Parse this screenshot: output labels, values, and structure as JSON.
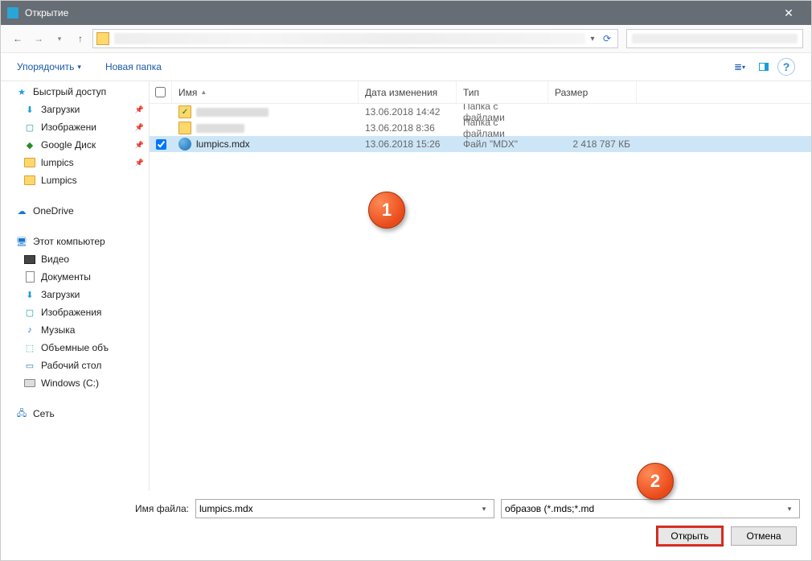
{
  "titlebar": {
    "title": "Открытие"
  },
  "toolbar": {
    "organize": "Упорядочить",
    "new_folder": "Новая папка"
  },
  "sidebar": {
    "quick_access": "Быстрый доступ",
    "downloads": "Загрузки",
    "images": "Изображени",
    "google_drive": "Google Диск",
    "lumpics": "lumpics",
    "lumpics2": "Lumpics",
    "onedrive": "OneDrive",
    "this_pc": "Этот компьютер",
    "video": "Видео",
    "documents": "Документы",
    "downloads2": "Загрузки",
    "images2": "Изображения",
    "music": "Музыка",
    "volumes": "Объемные объ",
    "desktop": "Рабочий стол",
    "c_drive": "Windows (C:)",
    "network": "Сеть"
  },
  "columns": {
    "name": "Имя",
    "date": "Дата изменения",
    "type": "Тип",
    "size": "Размер"
  },
  "rows": [
    {
      "name_blur": true,
      "date": "13.06.2018 14:42",
      "type": "Папка с файлами",
      "size": "",
      "icon": "folder-check"
    },
    {
      "name_blur": true,
      "date": "13.06.2018 8:36",
      "type": "Папка с файлами",
      "size": "",
      "icon": "folder"
    },
    {
      "name": "lumpics.mdx",
      "date": "13.06.2018 15:26",
      "type": "Файл \"MDX\"",
      "size": "2 418 787 КБ",
      "icon": "mdx",
      "selected": true,
      "checked": true
    }
  ],
  "footer": {
    "filename_label": "Имя файла:",
    "filename_value": "lumpics.mdx",
    "filter": "образов (*.mds;*.md",
    "open": "Открыть",
    "cancel": "Отмена"
  },
  "badges": {
    "b1": "1",
    "b2": "2"
  }
}
